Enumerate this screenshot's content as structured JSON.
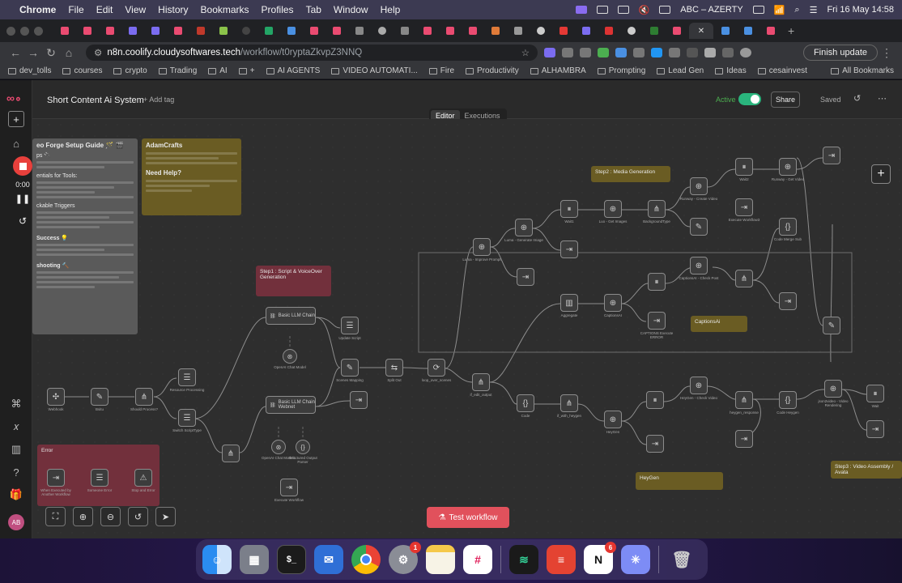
{
  "menubar": {
    "app": "Chrome",
    "items": [
      "File",
      "Edit",
      "View",
      "History",
      "Bookmarks",
      "Profiles",
      "Tab",
      "Window",
      "Help"
    ],
    "keyboard": "ABC – AZERTY",
    "datetime": "Fri 16 May  14:58"
  },
  "browser": {
    "url_host": "n8n.coolify.cloudysoftwares.tech",
    "url_path": "/workflow/t0ryptaZkvpZ3NNQ",
    "finish_update": "Finish update",
    "bookmarks": [
      "dev_tolls",
      "courses",
      "crypto",
      "Trading",
      "AI",
      "+",
      "AI AGENTS",
      "VIDEO AUTOMATI...",
      "Fire",
      "Productivity",
      "ALHAMBRA",
      "Prompting",
      "Lead Gen",
      "Ideas",
      "cesainvest"
    ],
    "all_bookmarks": "All Bookmarks"
  },
  "header": {
    "workflow_name": "Short Content Ai System",
    "add_tag": "+ Add tag",
    "active_label": "Active",
    "share": "Share",
    "saved": "Saved",
    "tabs": [
      "Editor",
      "Executions"
    ]
  },
  "recorder": {
    "time": "0:00"
  },
  "sidebar": {
    "avatar": "AB"
  },
  "stickies": {
    "guide_title": "eo Forge Setup Guide 🪄 🎬",
    "guide_lines": [
      "ps 🔌",
      "entials for Tools:",
      "ckable Triggers",
      "Success 💡",
      "shooting 🔨"
    ],
    "adamcrafts_title": "AdamCrafts",
    "need_help": "Need Help?",
    "step1": "Step1 : Script & VoiceOver Generation",
    "step2": "Step2 : Media Generation",
    "step3": "Step3 : Video Assembly / Avata",
    "captions": "CaptionsAi",
    "heygen": "HeyGen",
    "error": "Error"
  },
  "nodes": {
    "webhook": "Webhook",
    "ifdec": "Bsitu",
    "should_process": "Should Process?",
    "resource_processing": "Resource Processing",
    "switch_script": "Switch ScriptType",
    "basic_chain_1": "Basic LLM Chain",
    "basic_chain_2": "Basic LLM Chain Webnet",
    "openai_chat_1": "OpenAI Chat Model",
    "openai_chat_2": "OpenAI Chat Model1",
    "output_parser": "Structured Output Parser",
    "update_script": "Update Script",
    "scenes_mapping": "Scenes Mapping",
    "execute_workflow": "Execute Workflow",
    "split_out": "Split Out",
    "loop": "loop_over_scenes",
    "if_edit": "if_edit_output",
    "improve_prompt": "Luma - Improve Prompt",
    "luma_generate": "Luma - Generate Image",
    "wait": "Wait1",
    "luma_get": "Luo - Get Images",
    "background_type": "BackgroundType",
    "runway": "Runway - Create Video",
    "wait2": "Wait2",
    "runway_get": "Runway - Get Video",
    "execute_workflow_3": "Execute Workflow3",
    "code_merge": "Code Merge Sub",
    "aggregate": "Aggregate",
    "captions_ai": "CaptionsAI",
    "captions_check": "CaptionsAI - Check Post",
    "captions_execute": "CAPTIONS Execute ERROR",
    "code": "Code",
    "if_with_heygen": "if_with_heygen",
    "heygen": "HeyGen",
    "heygen_check": "HeyGen - Check Video",
    "heygen_response": "heygen_response",
    "code_heygen": "Code Heygen",
    "json2video": "json2video - Video Rendering",
    "wait_final": "Wait",
    "when_executed": "When Executed by Another Workflow",
    "send_error": "Someone Error",
    "stop_error": "Stop and Error"
  },
  "canvas": {
    "test_workflow": "Test workflow"
  },
  "dock": {
    "apps": [
      "Finder",
      "Launchpad",
      "Terminal",
      "Mail",
      "Chrome",
      "System Settings",
      "Notes",
      "Slack",
      "Sheets",
      "Todoist",
      "Notion",
      "Perplexity",
      "Trash"
    ],
    "settings_badge": "1",
    "notion_badge": "6"
  },
  "colors": {
    "n8n_accent": "#ea4b71",
    "active_green": "#2ab57d",
    "test_button": "#e1515c"
  }
}
